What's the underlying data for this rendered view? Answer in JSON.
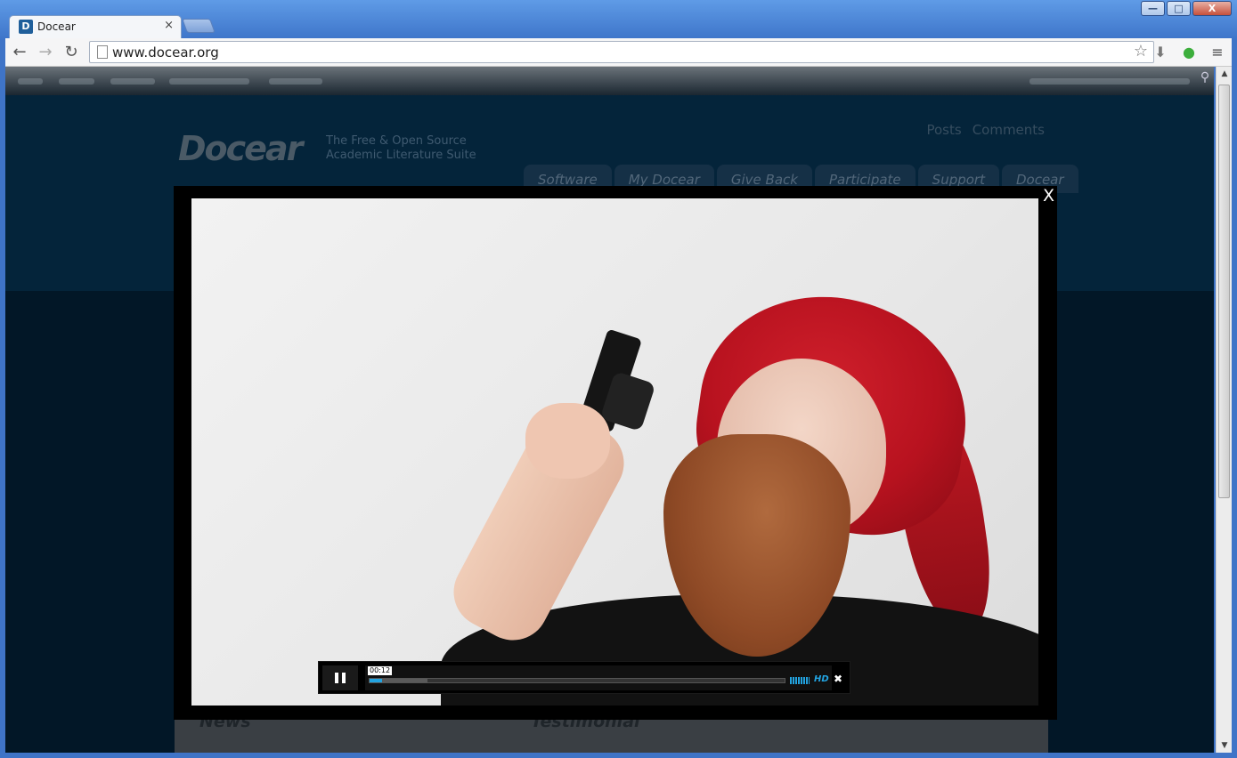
{
  "browser": {
    "tab_title": "Docear",
    "tab_favicon": "D",
    "tab_close": "×",
    "url": "www.docear.org",
    "window_controls": {
      "minimize": "—",
      "maximize": "□",
      "close": "X"
    },
    "nav": {
      "back": "←",
      "forward": "→",
      "reload": "↻"
    },
    "bookmark_icon": "☆",
    "menu_icon": "≡"
  },
  "site": {
    "logo_text": "Docear",
    "tagline": "The Free & Open Source Academic Literature Suite",
    "feed_links": [
      "Posts",
      "Comments"
    ],
    "menu": [
      "Software",
      "My Docear",
      "Give Back",
      "Participate",
      "Support",
      "Docear"
    ],
    "sections": [
      "News",
      "Testimonial"
    ]
  },
  "lightbox": {
    "close_label": "X",
    "player": {
      "time": "00:12",
      "played_fraction": 0.03,
      "loaded_fraction": 0.14,
      "hd_label": "HD",
      "state": "playing"
    }
  }
}
